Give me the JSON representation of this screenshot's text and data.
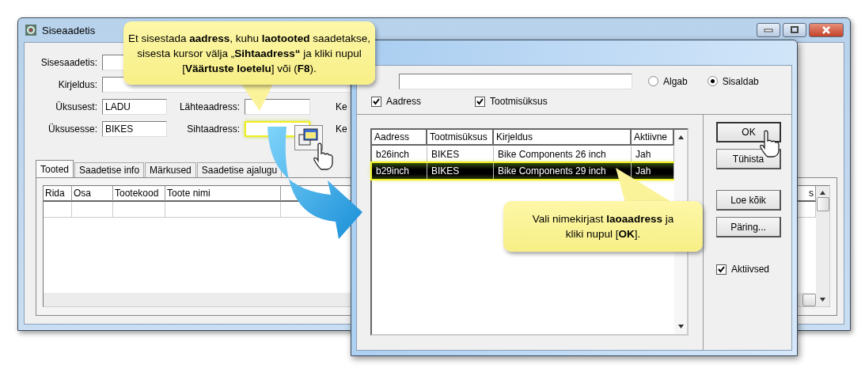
{
  "window": {
    "title": "Siseaadetis"
  },
  "form": {
    "wide_fields": [
      {
        "label": "Sisesaadetis:"
      },
      {
        "label": "Kirjeldus:"
      }
    ],
    "rows": [
      {
        "label": "Üksusest:",
        "value": "LADU",
        "label_2": "Lähteaadress:",
        "highlighted_2": false,
        "label_3": "Ke"
      },
      {
        "label": "Üksusesse:",
        "value": "BIKES",
        "label_2": "Sihtaadress:",
        "highlighted_2": true,
        "label_3": "Ke"
      }
    ]
  },
  "tabs": [
    {
      "label": "Tooted",
      "selected": true
    },
    {
      "label": "Saadetise info",
      "selected": false
    },
    {
      "label": "Märkused",
      "selected": false
    },
    {
      "label": "Saadetise ajalugu",
      "selected": false
    }
  ],
  "grid": {
    "columns": [
      "Rida",
      "Osa",
      "Tootekood",
      "Toote nimi"
    ],
    "column_6": "s"
  },
  "dialog": {
    "radios": [
      {
        "label": "Algab",
        "selected": false
      },
      {
        "label": "Sisaldab",
        "selected": true
      }
    ],
    "search_in": [
      {
        "label": "Aadress",
        "checked": true
      },
      {
        "label": "Tootmisüksus",
        "checked": true
      }
    ],
    "list": {
      "columns": [
        "Aadress",
        "Tootmisüksus",
        "Kirjeldus",
        "Aktiivne"
      ],
      "rows": [
        {
          "cells": [
            "b26inch",
            "BIKES",
            "Bike Components 26 inch",
            "Jah"
          ],
          "selected": false
        },
        {
          "cells": [
            "b29inch",
            "BIKES",
            "Bike Components 29 inch",
            "Jah"
          ],
          "selected": true
        }
      ]
    },
    "buttons": [
      {
        "label": "OK",
        "default": true
      },
      {
        "label": "Tühista",
        "default": false
      },
      {
        "label": "Loe kõik",
        "default": false
      },
      {
        "label": "Päring...",
        "default": false
      }
    ],
    "active_only": {
      "label": "Aktiivsed",
      "checked": true
    }
  },
  "callouts": [
    {
      "lines": [
        "Et sisestada **aadress**, kuhu **laotooted** saadetakse,",
        "sisesta kursor välja „**Sihtaadress“** ja kliki nupul",
        "[**Väärtuste loetelu**] või (**F8**)."
      ]
    },
    {
      "lines": [
        "Vali nimekirjast **laoaadress** ja",
        "kliki nupul [**OK**]."
      ]
    }
  ]
}
